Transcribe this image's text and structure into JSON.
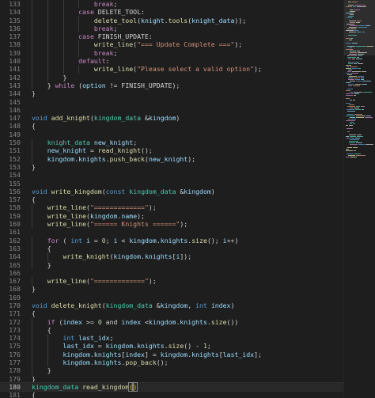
{
  "editor": {
    "current_line": "180",
    "lines": [
      {
        "n": "133",
        "t": [
          [
            "                ",
            ""
          ],
          [
            "break",
            "ctl"
          ],
          [
            ";",
            "p"
          ]
        ]
      },
      {
        "n": "134",
        "t": [
          [
            "            ",
            ""
          ],
          [
            "case",
            "ctl"
          ],
          [
            " DELETE_TOOL:",
            "p"
          ]
        ]
      },
      {
        "n": "135",
        "t": [
          [
            "                ",
            ""
          ],
          [
            "delete_tool",
            "fn"
          ],
          [
            "(",
            "p"
          ],
          [
            "knight",
            "var"
          ],
          [
            ".",
            "p"
          ],
          [
            "tools",
            "fn"
          ],
          [
            "(",
            "p"
          ],
          [
            "knight_data",
            "var"
          ],
          [
            "));",
            "p"
          ]
        ]
      },
      {
        "n": "136",
        "t": [
          [
            "                ",
            ""
          ],
          [
            "break",
            "ctl"
          ],
          [
            ";",
            "p"
          ]
        ]
      },
      {
        "n": "137",
        "t": [
          [
            "            ",
            ""
          ],
          [
            "case",
            "ctl"
          ],
          [
            " FINISH_UPDATE:",
            "p"
          ]
        ]
      },
      {
        "n": "138",
        "t": [
          [
            "                ",
            ""
          ],
          [
            "write_line",
            "fn"
          ],
          [
            "(",
            "p"
          ],
          [
            "\"=== Update Complete ===\"",
            "str"
          ],
          [
            ");",
            "p"
          ]
        ]
      },
      {
        "n": "139",
        "t": [
          [
            "                ",
            ""
          ],
          [
            "break",
            "ctl"
          ],
          [
            ";",
            "p"
          ]
        ]
      },
      {
        "n": "140",
        "t": [
          [
            "            ",
            ""
          ],
          [
            "default",
            "ctl"
          ],
          [
            ":",
            "p"
          ]
        ]
      },
      {
        "n": "141",
        "t": [
          [
            "                ",
            ""
          ],
          [
            "write_line",
            "fn"
          ],
          [
            "(",
            "p"
          ],
          [
            "\"Please select a valid option\"",
            "str"
          ],
          [
            ");",
            "p"
          ]
        ]
      },
      {
        "n": "142",
        "t": [
          [
            "        ",
            ""
          ],
          [
            "}",
            "p"
          ]
        ]
      },
      {
        "n": "143",
        "t": [
          [
            "    ",
            ""
          ],
          [
            "}",
            "p"
          ],
          [
            " ",
            ""
          ],
          [
            "while",
            "ctl"
          ],
          [
            " (",
            "p"
          ],
          [
            "option",
            "var"
          ],
          [
            " != FINISH_UPDATE);",
            "p"
          ]
        ]
      },
      {
        "n": "144",
        "t": [
          [
            "}",
            "p"
          ]
        ]
      },
      {
        "n": "145",
        "t": []
      },
      {
        "n": "146",
        "t": []
      },
      {
        "n": "147",
        "t": [
          [
            "void",
            "kw"
          ],
          [
            " ",
            ""
          ],
          [
            "add_knight",
            "fn"
          ],
          [
            "(",
            "p"
          ],
          [
            "kingdom_data",
            "type"
          ],
          [
            " &",
            "p"
          ],
          [
            "kingdom",
            "var"
          ],
          [
            ")",
            "p"
          ]
        ]
      },
      {
        "n": "148",
        "t": [
          [
            "{",
            "p"
          ]
        ]
      },
      {
        "n": "149",
        "t": []
      },
      {
        "n": "150",
        "t": [
          [
            "    ",
            ""
          ],
          [
            "knight_data",
            "type"
          ],
          [
            " ",
            ""
          ],
          [
            "new_knight",
            "var"
          ],
          [
            ";",
            "p"
          ]
        ]
      },
      {
        "n": "151",
        "t": [
          [
            "    ",
            ""
          ],
          [
            "new_knight",
            "var"
          ],
          [
            " = ",
            "p"
          ],
          [
            "read_knight",
            "fn"
          ],
          [
            "();",
            "p"
          ]
        ]
      },
      {
        "n": "152",
        "t": [
          [
            "    ",
            ""
          ],
          [
            "kingdom",
            "var"
          ],
          [
            ".",
            "p"
          ],
          [
            "knights",
            "var"
          ],
          [
            ".",
            "p"
          ],
          [
            "push_back",
            "fn"
          ],
          [
            "(",
            "p"
          ],
          [
            "new_knight",
            "var"
          ],
          [
            ");",
            "p"
          ]
        ]
      },
      {
        "n": "153",
        "t": [
          [
            "}",
            "p"
          ]
        ]
      },
      {
        "n": "154",
        "t": []
      },
      {
        "n": "155",
        "t": []
      },
      {
        "n": "156",
        "t": [
          [
            "void",
            "kw"
          ],
          [
            " ",
            ""
          ],
          [
            "write_kingdom",
            "fn"
          ],
          [
            "(",
            "p"
          ],
          [
            "const",
            "kw"
          ],
          [
            " ",
            ""
          ],
          [
            "kingdom_data",
            "type"
          ],
          [
            " &",
            "p"
          ],
          [
            "kingdom",
            "var"
          ],
          [
            ")",
            "p"
          ]
        ]
      },
      {
        "n": "157",
        "t": [
          [
            "{",
            "p"
          ]
        ]
      },
      {
        "n": "158",
        "t": [
          [
            "    ",
            ""
          ],
          [
            "write_line",
            "fn"
          ],
          [
            "(",
            "p"
          ],
          [
            "\"=============\"",
            "str"
          ],
          [
            ");",
            "p"
          ]
        ]
      },
      {
        "n": "159",
        "t": [
          [
            "    ",
            ""
          ],
          [
            "write_line",
            "fn"
          ],
          [
            "(",
            "p"
          ],
          [
            "kingdom",
            "var"
          ],
          [
            ".",
            "p"
          ],
          [
            "name",
            "var"
          ],
          [
            ");",
            "p"
          ]
        ]
      },
      {
        "n": "160",
        "t": [
          [
            "    ",
            ""
          ],
          [
            "write_line",
            "fn"
          ],
          [
            "(",
            "p"
          ],
          [
            "\"====== Knights ======\"",
            "str"
          ],
          [
            ");",
            "p"
          ]
        ]
      },
      {
        "n": "161",
        "t": []
      },
      {
        "n": "162",
        "t": [
          [
            "    ",
            ""
          ],
          [
            "for",
            "ctl"
          ],
          [
            " ( ",
            "p"
          ],
          [
            "int",
            "kw"
          ],
          [
            " ",
            ""
          ],
          [
            "i",
            "var"
          ],
          [
            " = ",
            "p"
          ],
          [
            "0",
            "num"
          ],
          [
            "; ",
            "p"
          ],
          [
            "i",
            "var"
          ],
          [
            " < ",
            "p"
          ],
          [
            "kingdom",
            "var"
          ],
          [
            ".",
            "p"
          ],
          [
            "knights",
            "var"
          ],
          [
            ".",
            "p"
          ],
          [
            "size",
            "fn"
          ],
          [
            "(); ",
            "p"
          ],
          [
            "i",
            "var"
          ],
          [
            "++)",
            "p"
          ]
        ]
      },
      {
        "n": "163",
        "t": [
          [
            "    ",
            ""
          ],
          [
            "{",
            "p"
          ]
        ]
      },
      {
        "n": "164",
        "t": [
          [
            "        ",
            ""
          ],
          [
            "write_knight",
            "fn"
          ],
          [
            "(",
            "p"
          ],
          [
            "kingdom",
            "var"
          ],
          [
            ".",
            "p"
          ],
          [
            "knights",
            "var"
          ],
          [
            "[",
            "p"
          ],
          [
            "i",
            "var"
          ],
          [
            "]);",
            "p"
          ]
        ]
      },
      {
        "n": "165",
        "t": [
          [
            "    ",
            ""
          ],
          [
            "}",
            "p"
          ]
        ]
      },
      {
        "n": "166",
        "t": []
      },
      {
        "n": "167",
        "t": [
          [
            "    ",
            ""
          ],
          [
            "write_line",
            "fn"
          ],
          [
            "(",
            "p"
          ],
          [
            "\"=============\"",
            "str"
          ],
          [
            ");",
            "p"
          ]
        ]
      },
      {
        "n": "168",
        "t": [
          [
            "}",
            "p"
          ]
        ]
      },
      {
        "n": "169",
        "t": []
      },
      {
        "n": "170",
        "t": [
          [
            "void",
            "kw"
          ],
          [
            " ",
            ""
          ],
          [
            "delete_knight",
            "fn"
          ],
          [
            "(",
            "p"
          ],
          [
            "kingdom_data",
            "type"
          ],
          [
            " &",
            "p"
          ],
          [
            "kingdom",
            "var"
          ],
          [
            ", ",
            "p"
          ],
          [
            "int",
            "kw"
          ],
          [
            " ",
            ""
          ],
          [
            "index",
            "var"
          ],
          [
            ")",
            "p"
          ]
        ]
      },
      {
        "n": "171",
        "t": [
          [
            "{",
            "p"
          ]
        ]
      },
      {
        "n": "172",
        "t": [
          [
            "    ",
            ""
          ],
          [
            "if",
            "ctl"
          ],
          [
            " (",
            "p"
          ],
          [
            "index",
            "var"
          ],
          [
            " >= ",
            "p"
          ],
          [
            "0",
            "num"
          ],
          [
            " and ",
            "p"
          ],
          [
            "index",
            "var"
          ],
          [
            " <",
            "p"
          ],
          [
            "kingdom",
            "var"
          ],
          [
            ".",
            "p"
          ],
          [
            "knights",
            "var"
          ],
          [
            ".",
            "p"
          ],
          [
            "size",
            "fn"
          ],
          [
            "()) ",
            "p"
          ]
        ]
      },
      {
        "n": "173",
        "t": [
          [
            "    ",
            ""
          ],
          [
            "{",
            "p"
          ]
        ]
      },
      {
        "n": "174",
        "t": [
          [
            "        ",
            ""
          ],
          [
            "int",
            "kw"
          ],
          [
            " ",
            ""
          ],
          [
            "last_idx",
            "var"
          ],
          [
            ";",
            "p"
          ]
        ]
      },
      {
        "n": "175",
        "t": [
          [
            "        ",
            ""
          ],
          [
            "last_idx",
            "var"
          ],
          [
            " = ",
            "p"
          ],
          [
            "kingdom",
            "var"
          ],
          [
            ".",
            "p"
          ],
          [
            "knights",
            "var"
          ],
          [
            ".",
            "p"
          ],
          [
            "size",
            "fn"
          ],
          [
            "() - ",
            "p"
          ],
          [
            "1",
            "num"
          ],
          [
            ";",
            "p"
          ]
        ]
      },
      {
        "n": "176",
        "t": [
          [
            "        ",
            ""
          ],
          [
            "kingdom",
            "var"
          ],
          [
            ".",
            "p"
          ],
          [
            "knights",
            "var"
          ],
          [
            "[",
            "p"
          ],
          [
            "index",
            "var"
          ],
          [
            "] = ",
            "p"
          ],
          [
            "kingdom",
            "var"
          ],
          [
            ".",
            "p"
          ],
          [
            "knights",
            "var"
          ],
          [
            "[",
            "p"
          ],
          [
            "last_idx",
            "var"
          ],
          [
            "];",
            "p"
          ]
        ]
      },
      {
        "n": "177",
        "t": [
          [
            "        ",
            ""
          ],
          [
            "kingdom",
            "var"
          ],
          [
            ".",
            "p"
          ],
          [
            "knights",
            "var"
          ],
          [
            ".",
            "p"
          ],
          [
            "pop_back",
            "fn"
          ],
          [
            "();",
            "p"
          ]
        ]
      },
      {
        "n": "178",
        "t": [
          [
            "    ",
            ""
          ],
          [
            "}",
            "p"
          ]
        ]
      },
      {
        "n": "179",
        "t": [
          [
            "}",
            "p"
          ]
        ]
      },
      {
        "n": "180",
        "t": [
          [
            "kingdom_data",
            "type"
          ],
          [
            " ",
            ""
          ],
          [
            "read_kingdom",
            "fn"
          ],
          [
            "(",
            "bm"
          ],
          [
            ")",
            "bm"
          ]
        ]
      },
      {
        "n": "181",
        "t": [
          [
            "{",
            "p"
          ]
        ]
      }
    ]
  },
  "minimap": {
    "colors": [
      "#569cd6",
      "#dcdcaa",
      "#9cdcfe",
      "#ce9178",
      "#c586c0",
      "#4ec9b0",
      "#d4d4d4"
    ]
  }
}
